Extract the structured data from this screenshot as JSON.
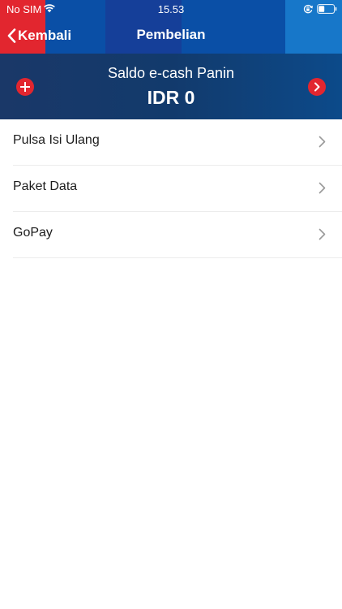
{
  "status_bar": {
    "carrier": "No SIM",
    "time": "15.53",
    "icons": [
      "wifi-icon",
      "rotation-lock-icon",
      "battery-icon"
    ],
    "battery_level": 0.4
  },
  "nav": {
    "back_label": "Kembali",
    "back_icon": "chevron-left-icon",
    "title": "Pembelian"
  },
  "balance": {
    "label": "Saldo e-cash Panin",
    "amount": "IDR 0",
    "topup_icon": "plus-circle-icon",
    "next_icon": "chevron-right-circle-icon"
  },
  "menu": {
    "items": [
      {
        "label": "Pulsa Isi Ulang",
        "icon": "chevron-right-icon"
      },
      {
        "label": "Paket Data",
        "icon": "chevron-right-icon"
      },
      {
        "label": "GoPay",
        "icon": "chevron-right-icon"
      }
    ]
  },
  "colors": {
    "header_blue": "#0a4fa6",
    "header_red": "#e2262f",
    "banner_navy": "#123a6c",
    "accent_red": "#e2262f",
    "text_dark": "#1c1c1c",
    "chevron_gray": "#9a9a9a",
    "divider": "#ececec"
  }
}
